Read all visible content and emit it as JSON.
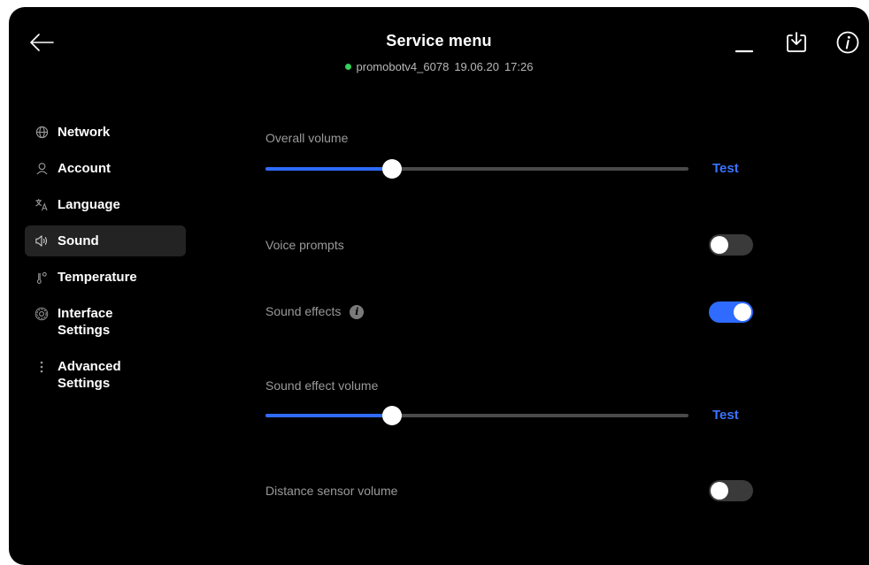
{
  "header": {
    "title": "Service menu",
    "device": "promobotv4_6078",
    "date": "19.06.20",
    "time": "17:26",
    "status_color": "#34d058"
  },
  "icons": {
    "back": "arrow-left-icon",
    "minimize": "minimize-icon",
    "download": "download-icon",
    "info": "info-icon"
  },
  "sidebar": {
    "items": [
      {
        "label": "Network",
        "icon": "globe-icon",
        "active": false
      },
      {
        "label": "Account",
        "icon": "user-icon",
        "active": false
      },
      {
        "label": "Language",
        "icon": "translate-icon",
        "active": false
      },
      {
        "label": "Sound",
        "icon": "speaker-icon",
        "active": true
      },
      {
        "label": "Temperature",
        "icon": "thermometer-icon",
        "active": false
      },
      {
        "label": "Interface Settings",
        "icon": "gear-icon",
        "active": false
      },
      {
        "label": "Advanced Settings",
        "icon": "more-vertical-icon",
        "active": false
      }
    ]
  },
  "sound": {
    "overall_volume": {
      "label": "Overall volume",
      "value_fraction": 0.3,
      "test_label": "Test"
    },
    "voice_prompts": {
      "label": "Voice prompts",
      "enabled": false
    },
    "sound_effects": {
      "label": "Sound effects",
      "enabled": true,
      "info_glyph": "i"
    },
    "sound_effect_volume": {
      "label": "Sound effect volume",
      "value_fraction": 0.3,
      "test_label": "Test"
    },
    "distance_sensor_volume": {
      "label": "Distance sensor volume",
      "enabled": false
    }
  },
  "colors": {
    "accent": "#2f6bff",
    "background": "#000000",
    "muted_text": "#9a9a9a"
  }
}
